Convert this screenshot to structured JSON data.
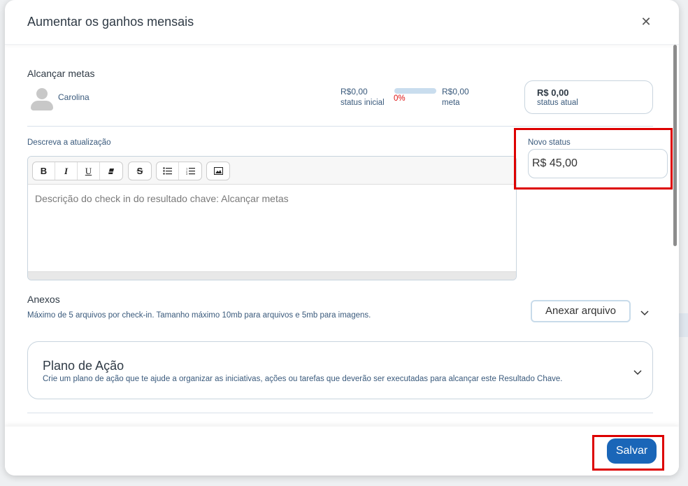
{
  "modal": {
    "title": "Aumentar os ganhos mensais",
    "close_icon": "close-icon"
  },
  "key_result": {
    "title": "Alcançar metas",
    "owner": "Carolina",
    "initial_value": "R$0,00",
    "initial_label": "status inicial",
    "progress_percent": 0,
    "progress_text": "0%",
    "target_value": "R$0,00",
    "target_label": "meta",
    "current_value": "R$ 0,00",
    "current_label": "status atual"
  },
  "update": {
    "label": "Descreva a atualização",
    "placeholder": "Descrição do check in do resultado chave: Alcançar metas",
    "toolbar": {
      "bold": "B",
      "italic": "I",
      "underline": "U",
      "eraser_icon": "eraser-icon",
      "strikethrough": "S",
      "bullet_list_icon": "bullet-list-icon",
      "numbered_list_icon": "numbered-list-icon",
      "image_icon": "image-icon"
    }
  },
  "new_status": {
    "label": "Novo status",
    "value": "R$ 45,00"
  },
  "attachments": {
    "title": "Anexos",
    "help": "Máximo de 5 arquivos por check-in. Tamanho máximo 10mb para arquivos e 5mb para imagens.",
    "button": "Anexar arquivo"
  },
  "action_plan": {
    "title": "Plano de Ação",
    "description": "Crie um plano de ação que te ajude a organizar as iniciativas, ações ou tarefas que deverão ser executadas para alcançar este Resultado Chave."
  },
  "footer": {
    "save": "Salvar"
  },
  "colors": {
    "highlight": "#dd0000",
    "primary": "#1a66b8",
    "percent": "#dd1111"
  }
}
